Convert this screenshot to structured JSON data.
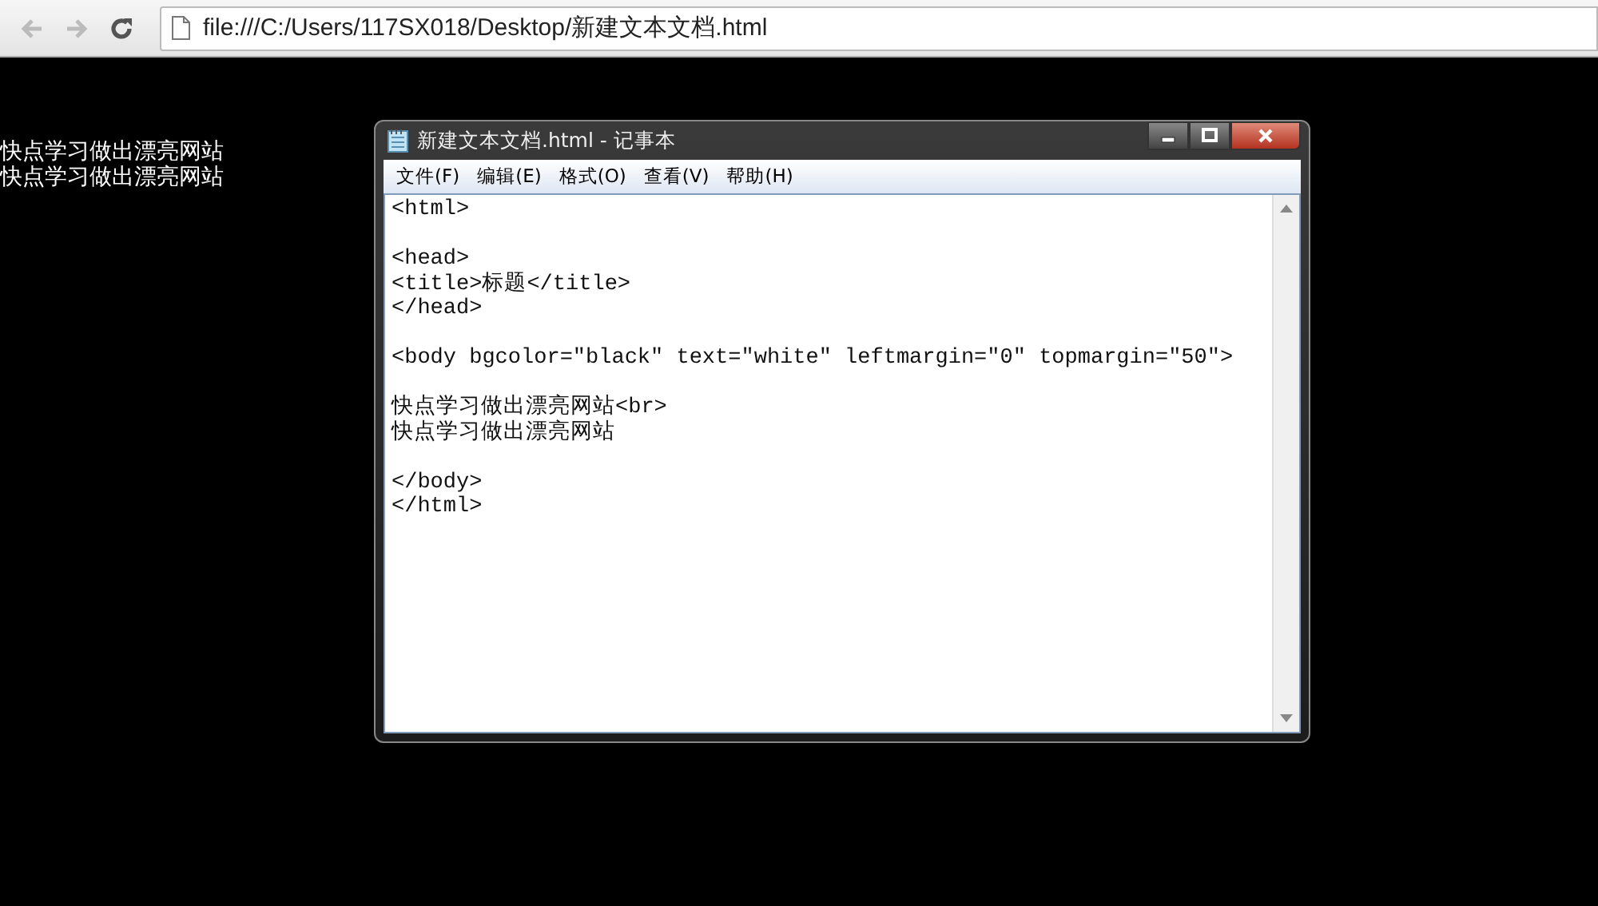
{
  "browser": {
    "nav_buttons": [
      {
        "kind": "back",
        "disabled": true
      },
      {
        "kind": "forward",
        "disabled": true
      },
      {
        "kind": "reload",
        "disabled": false
      }
    ],
    "address": "file:///C:/Users/117SX018/Desktop/新建文本文档.html"
  },
  "page": {
    "lines": [
      "快点学习做出漂亮网站",
      "快点学习做出漂亮网站"
    ]
  },
  "notepad": {
    "title": "新建文本文档.html - 记事本",
    "menu": [
      "文件(F)",
      "编辑(E)",
      "格式(O)",
      "查看(V)",
      "帮助(H)"
    ],
    "blocks": [
      [
        "<html>"
      ],
      [
        "<head>",
        "<title>标题</title>",
        "</head>"
      ],
      [
        "<body bgcolor=\"black\" text=\"white\" leftmargin=\"0\" topmargin=\"50\">"
      ],
      [
        "快点学习做出漂亮网站<br>",
        "快点学习做出漂亮网站"
      ],
      [
        "</body>",
        "</html>"
      ]
    ]
  }
}
